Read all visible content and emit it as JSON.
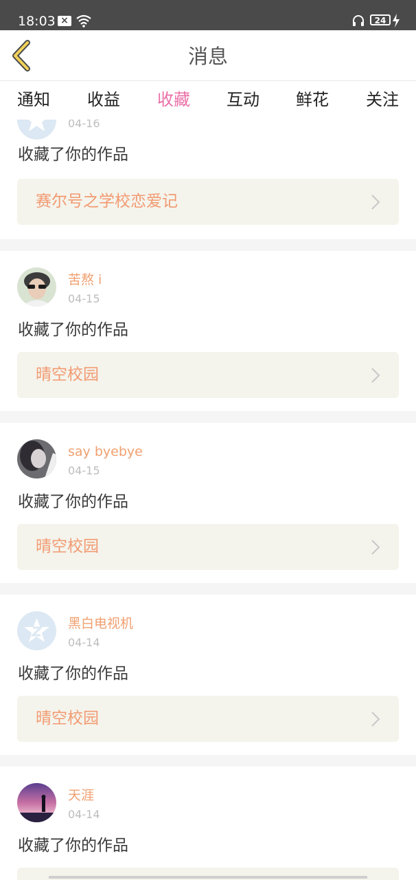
{
  "status_bar": {
    "time": "18:03",
    "battery": "24",
    "icons": [
      "close-box-icon",
      "wifi-icon",
      "headphones-icon",
      "battery-icon",
      "charging-bolt-icon"
    ]
  },
  "header": {
    "title": "消息",
    "back_icon": "chevron-left-icon"
  },
  "tabs": [
    {
      "label": "通知",
      "active": false
    },
    {
      "label": "收益",
      "active": false
    },
    {
      "label": "收藏",
      "active": true
    },
    {
      "label": "互动",
      "active": false
    },
    {
      "label": "鲜花",
      "active": false
    },
    {
      "label": "关注",
      "active": false
    }
  ],
  "feed": [
    {
      "user": "",
      "date": "04-16",
      "action": "收藏了你的作品",
      "work": "赛尔号之学校恋爱记"
    },
    {
      "user": "苦熬 i",
      "date": "04-15",
      "action": "收藏了你的作品",
      "work": "晴空校园"
    },
    {
      "user": "say byebye",
      "date": "04-15",
      "action": "收藏了你的作品",
      "work": "晴空校园"
    },
    {
      "user": "黑白电视机",
      "date": "04-14",
      "action": "收藏了你的作品",
      "work": "晴空校园"
    },
    {
      "user": "天涯",
      "date": "04-14",
      "action": "收藏了你的作品",
      "work": ""
    }
  ],
  "colors": {
    "accent": "#ea6fa7",
    "username": "#f0a070",
    "work_title": "#f29a72",
    "work_box": "#f4f4ec",
    "back_icon": "#e6b800"
  }
}
